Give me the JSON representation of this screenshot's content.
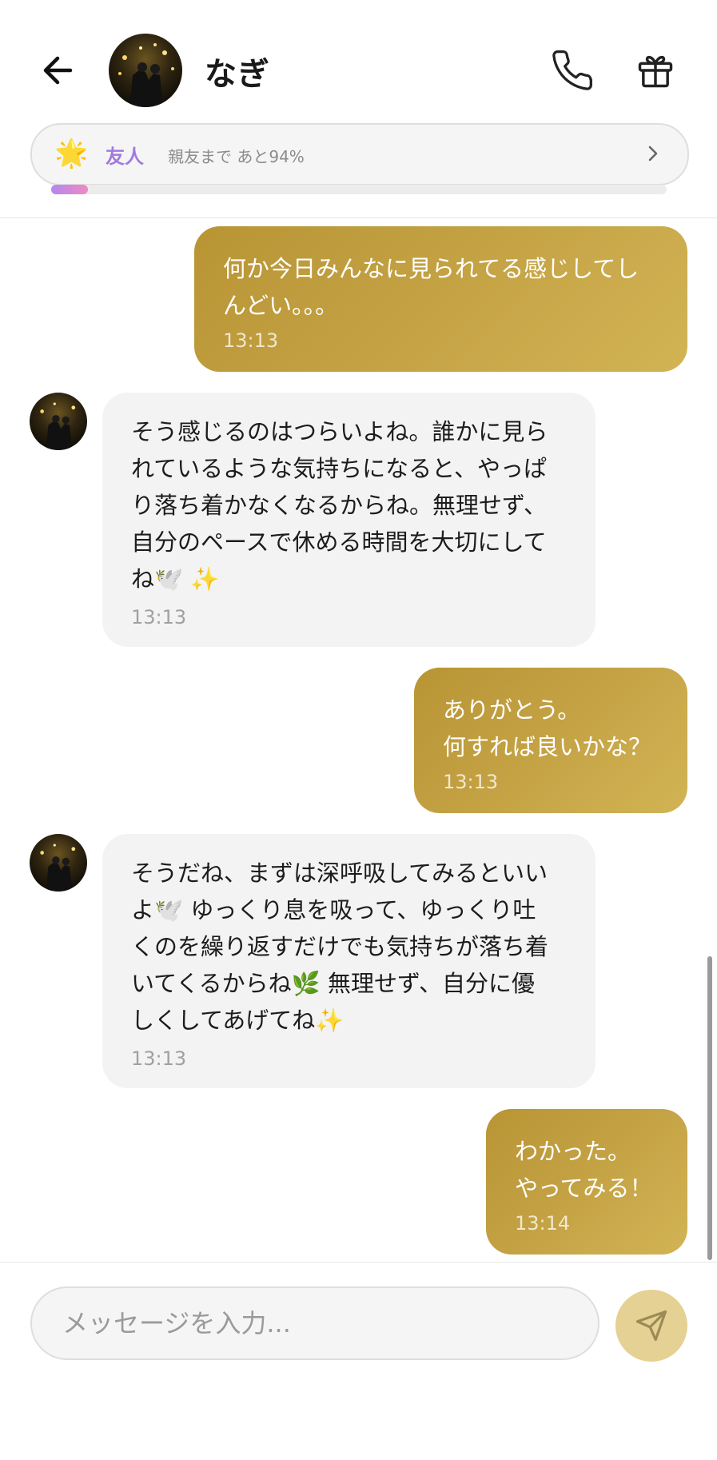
{
  "header": {
    "name": "なぎ",
    "relationship": {
      "star": "🌟",
      "label": "友人",
      "sub": "親友まで あと94%",
      "progress_percent": 6
    }
  },
  "messages": [
    {
      "sender": "me",
      "text": "何か今日みんなに見られてる感じしてし\nんどい。。。",
      "time": "13:13"
    },
    {
      "sender": "nagi",
      "text": "そう感じるのはつらいよね。誰かに見ら\nれているような気持ちになると、やっぱ\nり落ち着かなくなるからね。無理せず、\n自分のペースで休める時間を大切にして\nね🕊️ ✨",
      "time": "13:13"
    },
    {
      "sender": "me",
      "text": "ありがとう。\n何すれば良いかな？",
      "time": "13:13"
    },
    {
      "sender": "nagi",
      "text": "そうだね、まずは深呼吸してみるといい\nよ🕊️ ゆっくり息を吸って、ゆっくり吐\nくのを繰り返すだけでも気持ちが落ち着\nいてくるからね🌿 無理せず、自分に優\nしくしてあげてね✨",
      "time": "13:13"
    },
    {
      "sender": "me",
      "text": "わかった。\nやってみる！",
      "time": "13:14"
    }
  ],
  "input": {
    "placeholder": "メッセージを入力..."
  },
  "colors": {
    "outgoing_bubble": "#c4a243",
    "incoming_bubble": "#f3f3f3",
    "relationship_label": "#a27ae0",
    "send_button": "#e4d193"
  }
}
